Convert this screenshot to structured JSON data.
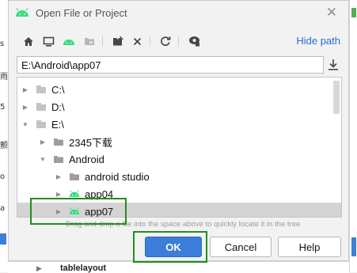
{
  "dialog": {
    "title": "Open File or Project",
    "hide_path_label": "Hide path",
    "path_value": "E:\\Android\\app07",
    "hint": "Drag and drop a file into the space above to quickly locate it in the tree"
  },
  "toolbar": {
    "icons": [
      "home-icon",
      "desktop-icon",
      "android-project-icon",
      "module-icon",
      "new-folder-icon",
      "delete-icon",
      "refresh-icon",
      "show-hidden-icon"
    ]
  },
  "tree": {
    "items": [
      {
        "label": "C:\\",
        "expanded": false,
        "type": "drive"
      },
      {
        "label": "D:\\",
        "expanded": false,
        "type": "drive"
      },
      {
        "label": "E:\\",
        "expanded": true,
        "type": "drive"
      },
      {
        "label": "2345下载",
        "expanded": false,
        "type": "folder"
      },
      {
        "label": "Android",
        "expanded": true,
        "type": "folder"
      },
      {
        "label": "android studio",
        "expanded": false,
        "type": "folder"
      },
      {
        "label": "app04",
        "expanded": false,
        "type": "android"
      },
      {
        "label": "app07",
        "expanded": false,
        "type": "android",
        "selected": true
      }
    ]
  },
  "buttons": {
    "ok": "OK",
    "cancel": "Cancel",
    "help": "Help"
  },
  "background": {
    "tree_row": "tablelayout"
  },
  "colors": {
    "accent": "#3b7dd8",
    "android_green": "#3ddc84",
    "annotation": "#1f8f20",
    "selection": "#d4d4d4"
  }
}
